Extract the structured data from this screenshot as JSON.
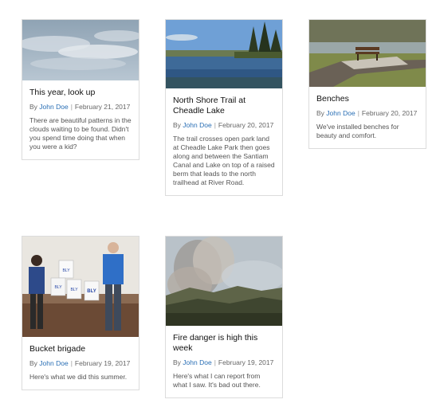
{
  "posts": [
    {
      "title": "This year, look up",
      "by": "By",
      "author": "John Doe",
      "date": "February 21, 2017",
      "excerpt": "There are beautiful patterns in the clouds waiting to be found. Didn't you spend time doing that when you were a kid?",
      "image": "clouds-photo"
    },
    {
      "title": "North Shore Trail at Cheadle Lake",
      "by": "By",
      "author": "John Doe",
      "date": "February 20, 2017",
      "excerpt": "The trail crosses open park land at Cheadle Lake Park then goes along and between the Santiam Canal and Lake on top of a raised berm that leads to the north trailhead at River Road.",
      "image": "lake-photo"
    },
    {
      "title": "Benches",
      "by": "By",
      "author": "John Doe",
      "date": "February 20, 2017",
      "excerpt": "We've installed benches for beauty and comfort.",
      "image": "bench-photo"
    },
    {
      "title": "Bucket brigade",
      "by": "By",
      "author": "John Doe",
      "date": "February 19, 2017",
      "excerpt": "Here's what we did this summer.",
      "image": "buckets-photo",
      "bucket_labels": [
        "BLY",
        "BLY",
        "BLY",
        "BLY"
      ]
    },
    {
      "title": "Fire danger is high this week",
      "by": "By",
      "author": "John Doe",
      "date": "February 19, 2017",
      "excerpt": "Here's what I can report from what I saw. It's bad out there.",
      "image": "smoke-photo"
    }
  ]
}
